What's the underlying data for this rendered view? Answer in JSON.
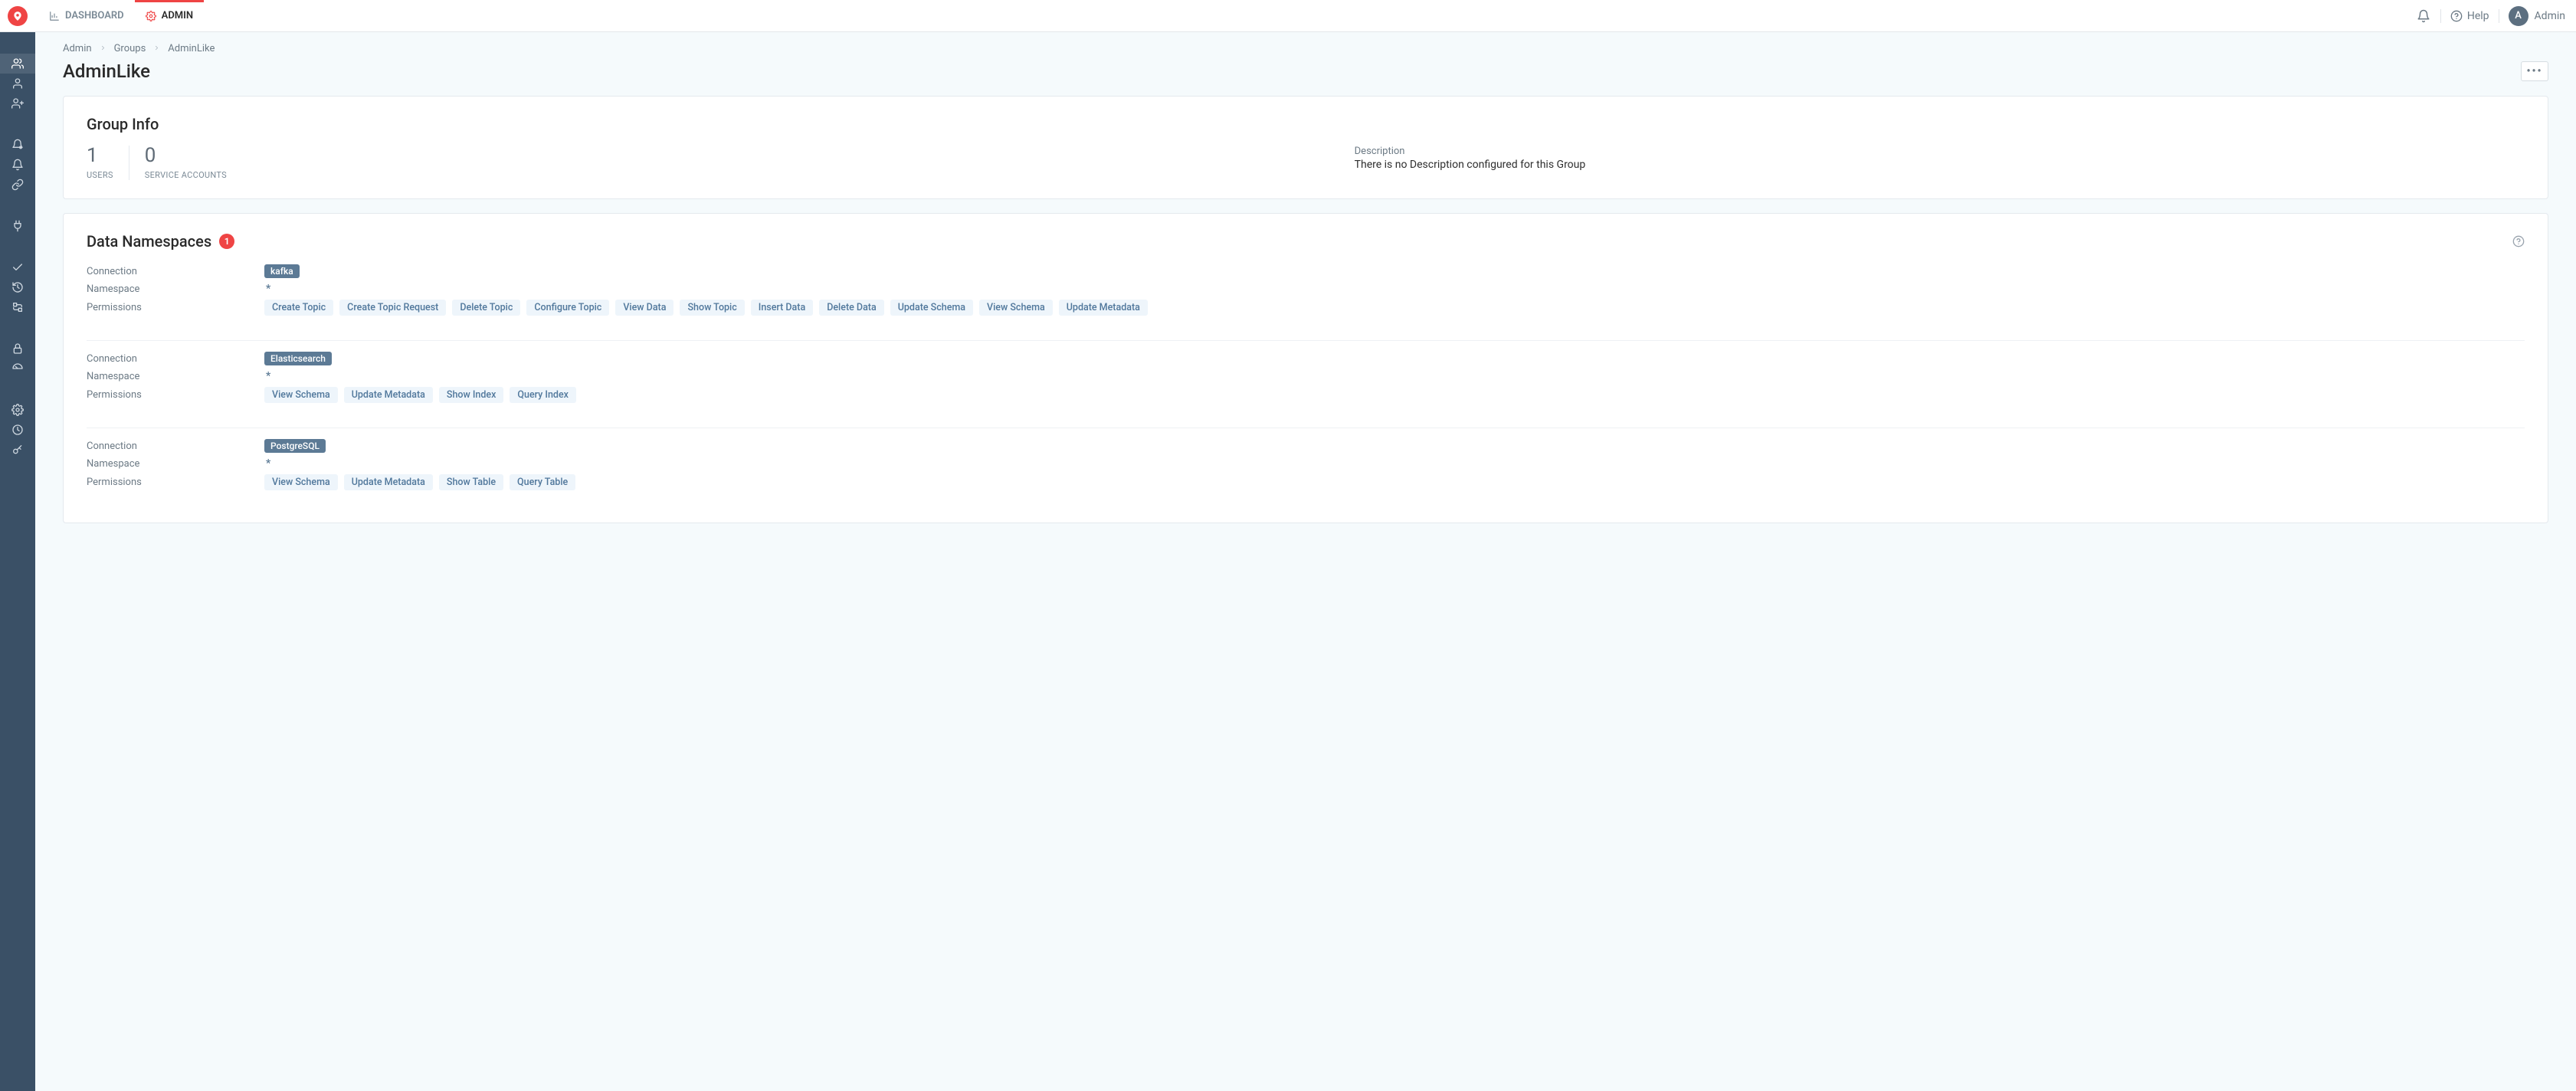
{
  "header": {
    "nav": [
      {
        "label": "DASHBOARD",
        "icon": "bar-chart-icon",
        "active": false
      },
      {
        "label": "ADMIN",
        "icon": "gear-icon",
        "active": true
      }
    ],
    "help_label": "Help",
    "user": {
      "initial": "A",
      "name": "Admin"
    }
  },
  "sidebar": {
    "groups": [
      [
        {
          "name": "sidebar-item-groups",
          "icon": "users-icon",
          "active": true
        },
        {
          "name": "sidebar-item-user",
          "icon": "user-icon",
          "active": false
        },
        {
          "name": "sidebar-item-user-plus",
          "icon": "user-plus-icon",
          "active": false
        }
      ],
      [
        {
          "name": "sidebar-item-alert-settings",
          "icon": "bell-gear-icon",
          "active": false
        },
        {
          "name": "sidebar-item-alerts",
          "icon": "bell-icon",
          "active": false
        },
        {
          "name": "sidebar-item-links",
          "icon": "link-icon",
          "active": false
        }
      ],
      [
        {
          "name": "sidebar-item-plugin",
          "icon": "plug-icon",
          "active": false
        }
      ],
      [
        {
          "name": "sidebar-item-check",
          "icon": "check-icon",
          "active": false
        },
        {
          "name": "sidebar-item-history",
          "icon": "history-icon",
          "active": false
        },
        {
          "name": "sidebar-item-flow",
          "icon": "flow-icon",
          "active": false
        }
      ],
      [
        {
          "name": "sidebar-item-security",
          "icon": "lock-icon",
          "active": false
        },
        {
          "name": "sidebar-item-dashboard",
          "icon": "gauge-icon",
          "active": false
        }
      ],
      [
        {
          "name": "sidebar-item-settings",
          "icon": "gear-icon",
          "active": false
        },
        {
          "name": "sidebar-item-schedule",
          "icon": "clock-icon",
          "active": false
        },
        {
          "name": "sidebar-item-keys",
          "icon": "key-icon",
          "active": false
        }
      ]
    ]
  },
  "breadcrumbs": [
    "Admin",
    "Groups",
    "AdminLike"
  ],
  "page_title": "AdminLike",
  "group_info": {
    "title": "Group Info",
    "stats": [
      {
        "value": "1",
        "label": "USERS"
      },
      {
        "value": "0",
        "label": "SERVICE ACCOUNTS"
      }
    ],
    "description_label": "Description",
    "description_text": "There is no Description configured for this Group"
  },
  "data_namespaces": {
    "title": "Data Namespaces",
    "count": "1",
    "row_labels": {
      "connection": "Connection",
      "namespace": "Namespace",
      "permissions": "Permissions"
    },
    "items": [
      {
        "connection": "kafka",
        "namespace": "*",
        "permissions": [
          "Create Topic",
          "Create Topic Request",
          "Delete Topic",
          "Configure Topic",
          "View Data",
          "Show Topic",
          "Insert Data",
          "Delete Data",
          "Update Schema",
          "View Schema",
          "Update Metadata"
        ]
      },
      {
        "connection": "Elasticsearch",
        "namespace": "*",
        "permissions": [
          "View Schema",
          "Update Metadata",
          "Show Index",
          "Query Index"
        ]
      },
      {
        "connection": "PostgreSQL",
        "namespace": "*",
        "permissions": [
          "View Schema",
          "Update Metadata",
          "Show Table",
          "Query Table"
        ]
      }
    ]
  }
}
